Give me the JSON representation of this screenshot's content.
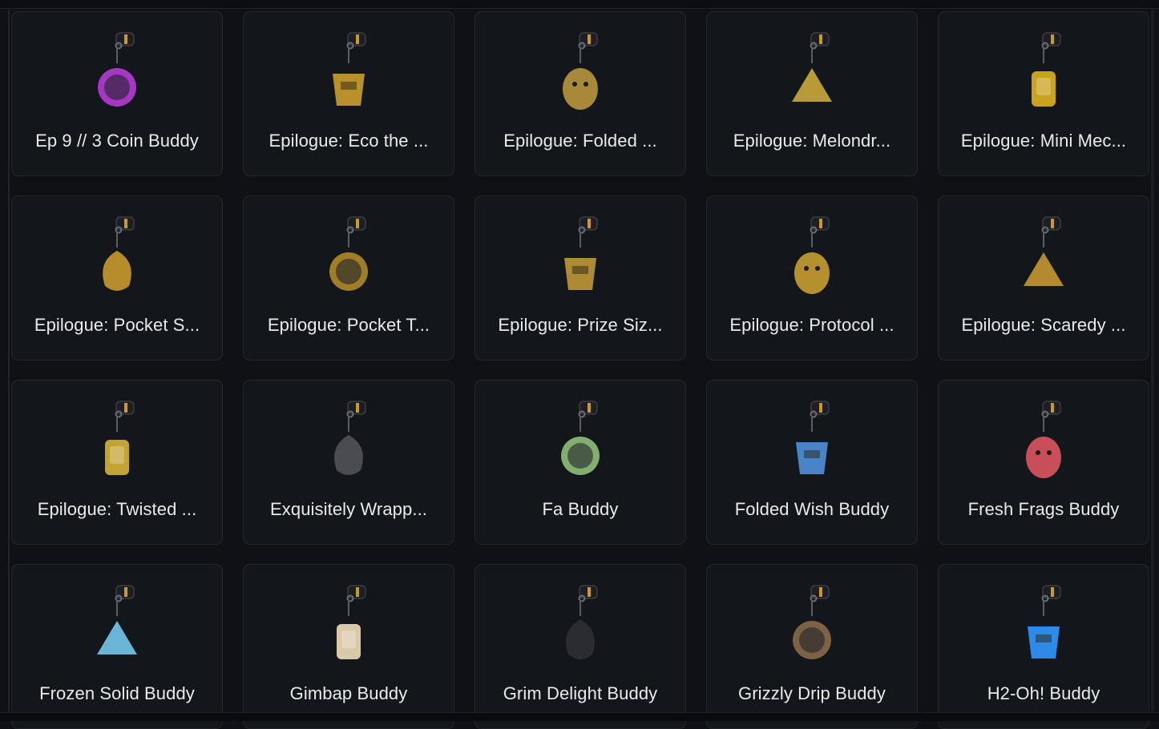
{
  "items": [
    {
      "name": "Ep 9 // 3 Coin Buddy",
      "icon": "ep9-coin-charm-icon",
      "accent": "#b63bd6"
    },
    {
      "name": "Epilogue: Eco the ...",
      "icon": "dollar-mask-charm-icon",
      "accent": "#b8912c"
    },
    {
      "name": "Epilogue: Folded ...",
      "icon": "paper-crane-charm-icon",
      "accent": "#a8893a"
    },
    {
      "name": "Epilogue: Melondr...",
      "icon": "melon-slice-charm-icon",
      "accent": "#b89a36"
    },
    {
      "name": "Epilogue: Mini Mec...",
      "icon": "mini-mech-charm-icon",
      "accent": "#c9a21f"
    },
    {
      "name": "Epilogue: Pocket S...",
      "icon": "pocket-sword-charm-icon",
      "accent": "#b68b2a"
    },
    {
      "name": "Epilogue: Pocket T...",
      "icon": "pocket-orb-charm-icon",
      "accent": "#b08a2a"
    },
    {
      "name": "Epilogue: Prize Siz...",
      "icon": "prize-robot-charm-icon",
      "accent": "#ad8a34"
    },
    {
      "name": "Epilogue: Protocol ...",
      "icon": "protocol-bot-charm-icon",
      "accent": "#b5902f"
    },
    {
      "name": "Epilogue: Scaredy ...",
      "icon": "scaredy-critter-charm-icon",
      "accent": "#b48a30"
    },
    {
      "name": "Epilogue: Twisted ...",
      "icon": "pretzel-charm-icon",
      "accent": "#c4a335"
    },
    {
      "name": "Exquisitely Wrapp...",
      "icon": "gift-box-charm-icon",
      "accent": "#4a4c52"
    },
    {
      "name": "Fa Buddy",
      "icon": "mahjong-tile-charm-icon",
      "accent": "#8fbf7a"
    },
    {
      "name": "Folded Wish Buddy",
      "icon": "blue-crane-charm-icon",
      "accent": "#4a84c8"
    },
    {
      "name": "Fresh Frags Buddy",
      "icon": "flower-knife-charm-icon",
      "accent": "#c84f5a"
    },
    {
      "name": "Frozen Solid Buddy",
      "icon": "ice-block-charm-icon",
      "accent": "#6ab5d8"
    },
    {
      "name": "Gimbap Buddy",
      "icon": "gimbap-charm-icon",
      "accent": "#d8c9a8"
    },
    {
      "name": "Grim Delight Buddy",
      "icon": "grim-cloak-charm-icon",
      "accent": "#2a2c31"
    },
    {
      "name": "Grizzly Drip Buddy",
      "icon": "grizzly-bear-charm-icon",
      "accent": "#8a6a4a"
    },
    {
      "name": "H2-Oh! Buddy",
      "icon": "water-bottle-charm-icon",
      "accent": "#2d8ae8"
    }
  ]
}
